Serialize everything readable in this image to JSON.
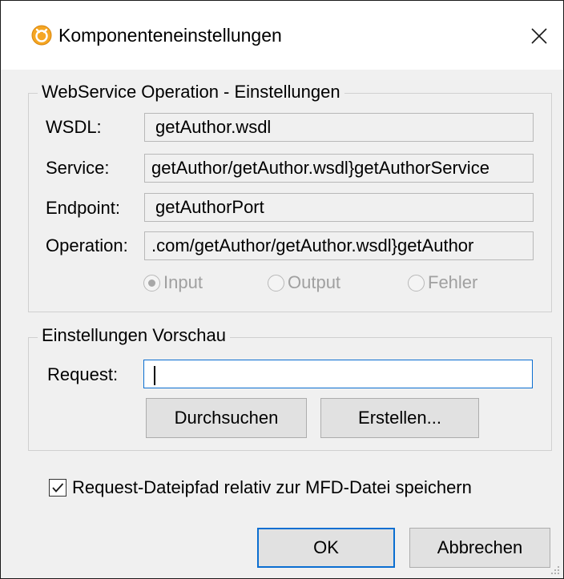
{
  "dialog": {
    "title": "Komponenteneinstellungen",
    "close_label": "✕"
  },
  "operation_group": {
    "legend": "WebService Operation - Einstellungen",
    "wsdl_label": "WSDL:",
    "wsdl_value": "getAuthor.wsdl",
    "service_label": "Service:",
    "service_value": "getAuthor/getAuthor.wsdl}getAuthorService",
    "endpoint_label": "Endpoint:",
    "endpoint_value": "getAuthorPort",
    "operation_label": "Operation:",
    "operation_value": ".com/getAuthor/getAuthor.wsdl}getAuthor",
    "radios": [
      {
        "label": "Input",
        "selected": true
      },
      {
        "label": "Output",
        "selected": false
      },
      {
        "label": "Fehler",
        "selected": false
      }
    ]
  },
  "preview_group": {
    "legend": "Einstellungen Vorschau",
    "request_label": "Request:",
    "request_value": "",
    "browse_button": "Durchsuchen",
    "create_button": "Erstellen..."
  },
  "save_relative": {
    "label": "Request-Dateipfad relativ zur MFD-Datei speichern",
    "checked": true
  },
  "footer": {
    "ok_button": "OK",
    "cancel_button": "Abbrechen"
  },
  "colors": {
    "focus_blue": "#0a6ed1",
    "app_icon_orange": "#f5a623",
    "dialog_bg": "#f0f0f0"
  }
}
